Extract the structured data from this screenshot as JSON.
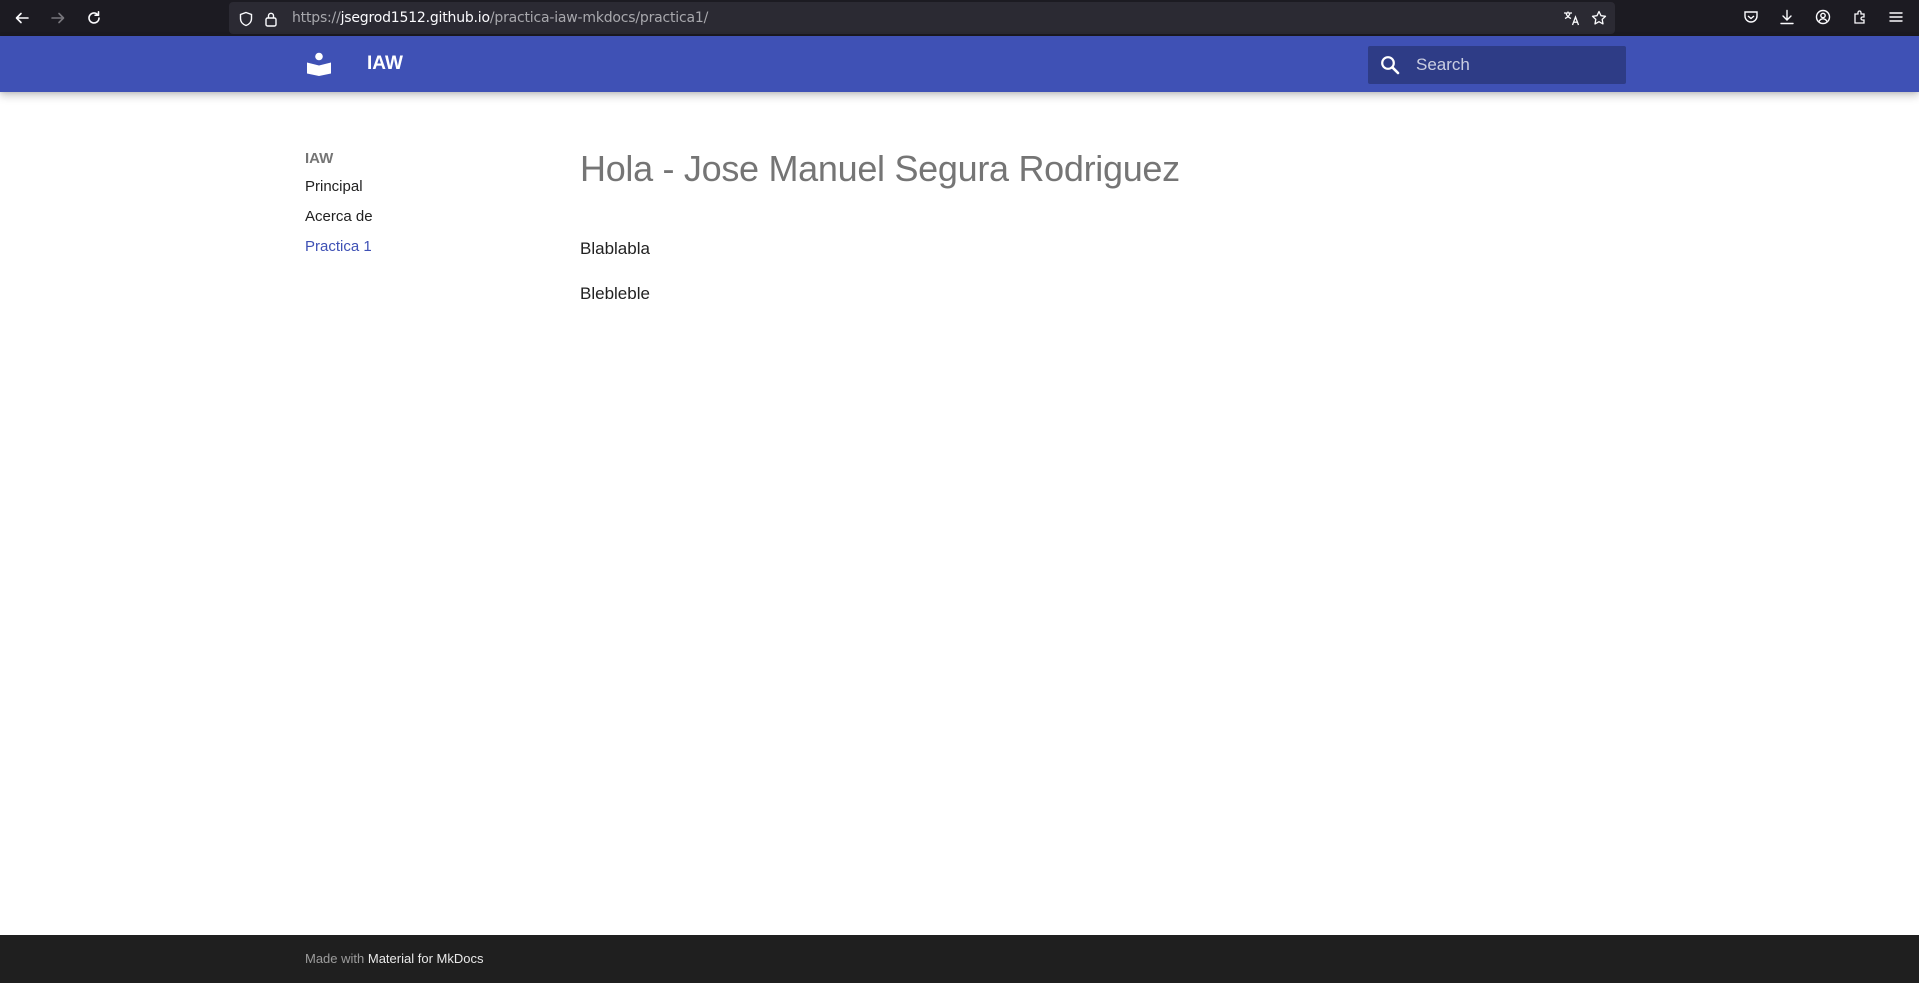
{
  "browser": {
    "url_host": "https://jsegrod1512.github.io",
    "url_host_scheme": "https://",
    "url_host_domain": "jsegrod1512.github.io",
    "url_path": "/practica-iaw-mkdocs/practica1/"
  },
  "header": {
    "site_title": "IAW",
    "search_placeholder": "Search"
  },
  "sidebar": {
    "title": "IAW",
    "items": [
      {
        "label": "Principal",
        "active": false
      },
      {
        "label": "Acerca de",
        "active": false
      },
      {
        "label": "Practica 1",
        "active": true
      }
    ]
  },
  "main": {
    "heading": "Hola - Jose Manuel Segura Rodriguez",
    "paragraphs": [
      "Blablabla",
      "Blebleble"
    ]
  },
  "footer": {
    "prefix": "Made with ",
    "link_label": "Material for MkDocs"
  },
  "colors": {
    "primary": "#3f51b5",
    "footer_bg": "#1f1f1f",
    "browser_bg": "#1c1b22"
  }
}
